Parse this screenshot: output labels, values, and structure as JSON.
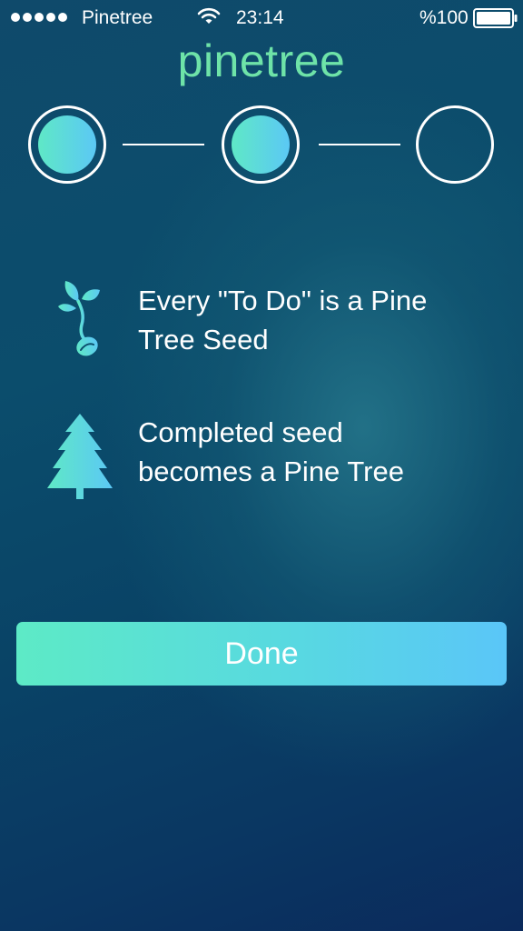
{
  "status_bar": {
    "carrier": "Pinetree",
    "time": "23:14",
    "battery": "%100",
    "signal_icon": "signal-dots-icon",
    "wifi_icon": "wifi-icon",
    "battery_icon": "battery-full-icon"
  },
  "app": {
    "title": "pinetree"
  },
  "steps": [
    {
      "state": "completed"
    },
    {
      "state": "completed"
    },
    {
      "state": "empty"
    }
  ],
  "features": [
    {
      "icon": "sprout-icon",
      "line1": "Every \"To Do\" is a Pine",
      "line2": "Tree Seed"
    },
    {
      "icon": "pine-tree-icon",
      "line1": "Completed seed",
      "line2": "becomes a Pine Tree"
    }
  ],
  "done_button": {
    "label": "Done"
  },
  "colors": {
    "accent_start": "#5deac6",
    "accent_end": "#5ac6f8",
    "title": "#6ee3a8",
    "background": "#0b4d6c"
  }
}
